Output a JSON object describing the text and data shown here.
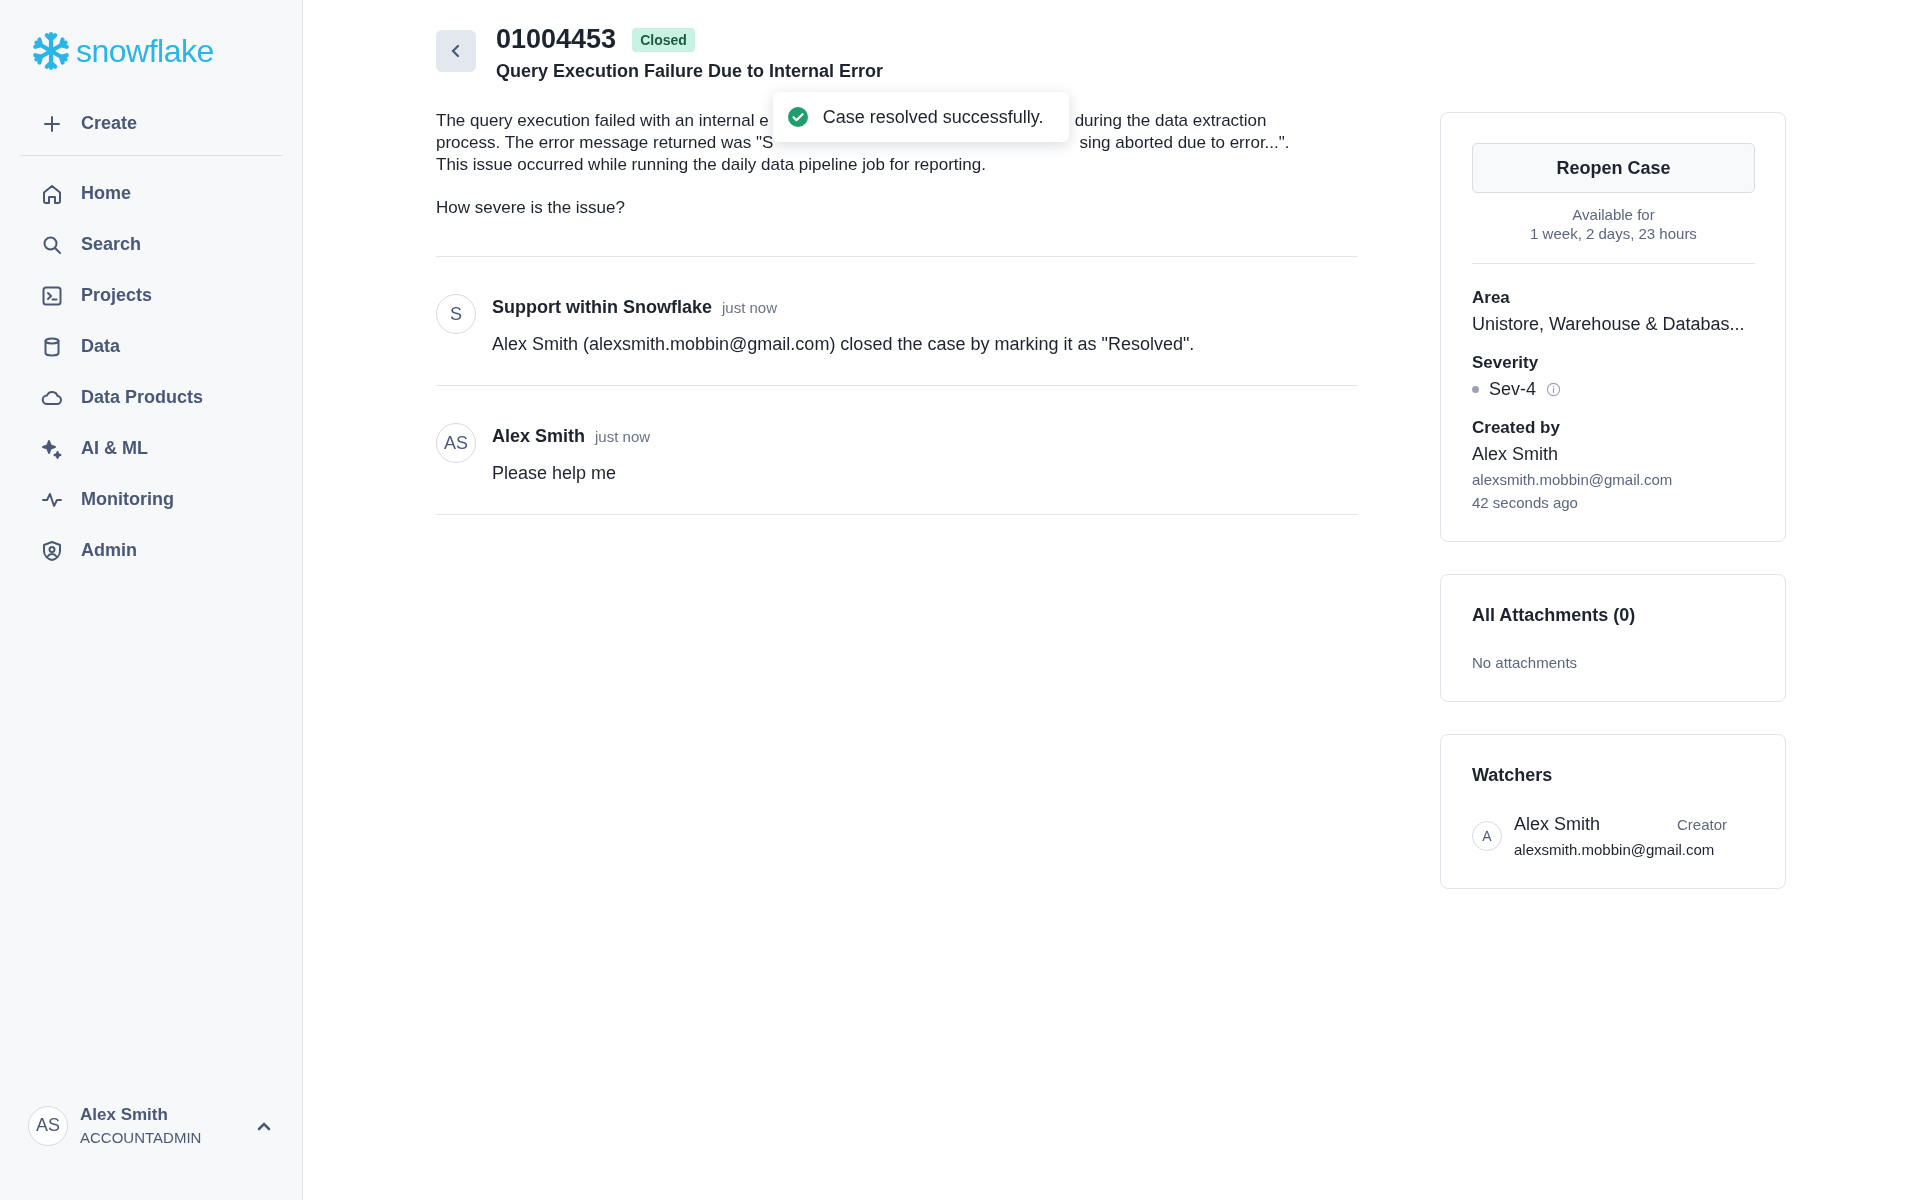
{
  "brand": {
    "name": "snowflake"
  },
  "sidebar": {
    "create": "Create",
    "items": [
      {
        "label": "Home",
        "kind": "home"
      },
      {
        "label": "Search",
        "kind": "search"
      },
      {
        "label": "Projects",
        "kind": "projects"
      },
      {
        "label": "Data",
        "kind": "data"
      },
      {
        "label": "Data Products",
        "kind": "cloud"
      },
      {
        "label": "AI & ML",
        "kind": "ai"
      },
      {
        "label": "Monitoring",
        "kind": "monitoring"
      },
      {
        "label": "Admin",
        "kind": "admin"
      }
    ],
    "user": {
      "initials": "AS",
      "name": "Alex Smith",
      "role": "ACCOUNTADMIN"
    }
  },
  "case": {
    "number": "01004453",
    "status": "Closed",
    "title": "Query Execution Failure Due to Internal Error",
    "description_lines": [
      {
        "left": "The query execution failed with an internal e",
        "right": "during the data extraction"
      },
      {
        "left": "process. The error message returned was \"S",
        "right": "sing aborted due to error...\"."
      },
      {
        "left": "This issue occurred while running the daily data pipeline job for reporting."
      }
    ],
    "question": "How severe is the issue?"
  },
  "toast": {
    "message": "Case resolved successfully."
  },
  "activity": [
    {
      "initials": "S",
      "author": "Support within Snowflake",
      "time": "just now",
      "text": "Alex Smith (alexsmith.mobbin@gmail.com) closed the case by marking it as \"Resolved\"."
    },
    {
      "initials": "AS",
      "author": "Alex Smith",
      "time": "just now",
      "text": "Please help me"
    }
  ],
  "details": {
    "action": "Reopen Case",
    "availability": [
      "Available for",
      "1 week, 2 days, 23 hours"
    ],
    "area": {
      "label": "Area",
      "value": "Unistore, Warehouse & Databas..."
    },
    "severity": {
      "label": "Severity",
      "value": "Sev-4"
    },
    "created_by": {
      "label": "Created by",
      "name": "Alex Smith",
      "email": "alexsmith.mobbin@gmail.com",
      "time": "42 seconds ago"
    }
  },
  "attachments": {
    "title": "All Attachments (0)",
    "empty": "No attachments"
  },
  "watchers": {
    "title": "Watchers",
    "items": [
      {
        "initial": "A",
        "name": "Alex Smith",
        "role": "Creator",
        "email": "alexsmith.mobbin@gmail.com"
      }
    ]
  }
}
